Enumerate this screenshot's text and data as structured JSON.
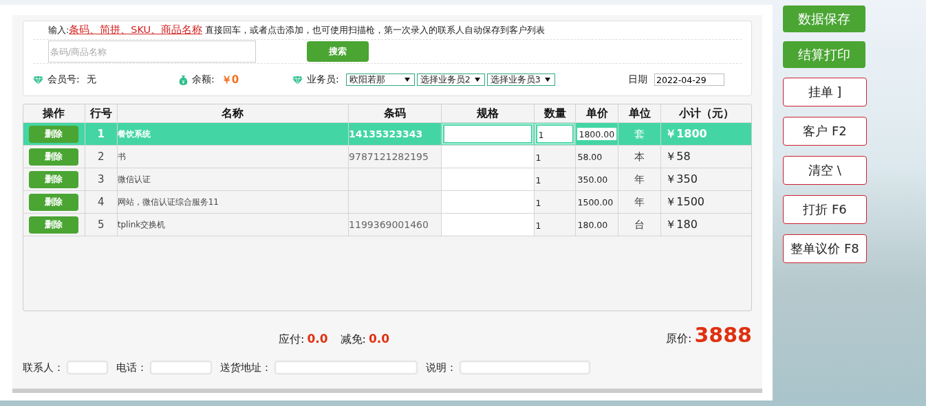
{
  "intro": {
    "prefix": "输入:",
    "link": "条码、简拼、SKU、商品名称",
    "suffix": " 直接回车，或者点击添加，也可使用扫描枪，第一次录入的联系人自动保存到客户列表"
  },
  "search": {
    "placeholder": "条码/商品名称",
    "button": "搜索"
  },
  "member": {
    "label": "会员号:",
    "value": "无"
  },
  "balance": {
    "label": "余额:",
    "value": "￥0"
  },
  "salesman": {
    "label": "业务员:",
    "selects": [
      "欧阳若那",
      "选择业务员2",
      "选择业务员3"
    ]
  },
  "date": {
    "label": "日期",
    "value": "2022-04-29"
  },
  "table": {
    "columns": [
      "操作",
      "行号",
      "名称",
      "条码",
      "规格",
      "数量",
      "单价",
      "单位",
      "小计（元）"
    ],
    "rows": [
      {
        "selected": true,
        "action": "删除",
        "no": "1",
        "name": "餐饮系统",
        "barcode": "14135323343",
        "qty": "1",
        "price": "1800.00",
        "unit": "套",
        "subtotal": "￥1800"
      },
      {
        "selected": false,
        "action": "删除",
        "no": "2",
        "name": "书",
        "barcode": "9787121282195",
        "qty": "1",
        "price": "58.00",
        "unit": "本",
        "subtotal": "￥58"
      },
      {
        "selected": false,
        "action": "删除",
        "no": "3",
        "name": "微信认证",
        "qty": "1",
        "price": "350.00",
        "unit": "年",
        "subtotal": "￥350"
      },
      {
        "selected": false,
        "action": "删除",
        "no": "4",
        "name": "网站，微信认证综合服务11",
        "qty": "1",
        "price": "1500.00",
        "unit": "年",
        "subtotal": "￥1500"
      },
      {
        "selected": false,
        "action": "删除",
        "no": "5",
        "name": "tplink交换机",
        "barcode": "1199369001460",
        "qty": "1",
        "price": "180.00",
        "unit": "台",
        "subtotal": "￥180"
      }
    ]
  },
  "totals": {
    "payable_label": "应付:",
    "payable": "0.0",
    "reduction_label": "减免:",
    "reduction": "0.0",
    "original_label": "原价:",
    "original": "3888"
  },
  "contact_fields": [
    {
      "label": "联系人："
    },
    {
      "label": "电话："
    },
    {
      "label": "送货地址："
    },
    {
      "label": "说明："
    }
  ],
  "side_buttons": [
    {
      "label": "数据保存",
      "kind": "primary"
    },
    {
      "label": "结算打印",
      "kind": "primary"
    },
    {
      "label": "挂单 ]",
      "kind": "outline"
    },
    {
      "label": "客户 F2",
      "kind": "outline"
    },
    {
      "label": "清空 \\",
      "kind": "outline"
    },
    {
      "label": "打折 F6",
      "kind": "outline"
    },
    {
      "label": "整单议价 F8",
      "kind": "outline"
    }
  ]
}
